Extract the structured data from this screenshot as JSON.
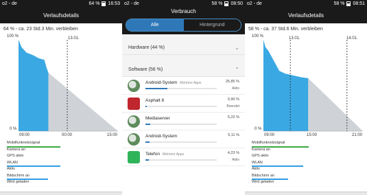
{
  "colors": {
    "accent": "#2f9ee0",
    "chart_fill": "#3aa8e3",
    "projection": "#cfd3d8",
    "green": "#39a845",
    "blue": "#2f78b8",
    "title_bg": "#1a1a1a"
  },
  "panels": [
    {
      "status": {
        "carrier": "o2 - de",
        "battery": "64 %",
        "time": "16:53"
      },
      "title": "Verlaufsdetails",
      "summary": "64 % - ca. 23 Std.3 Min. verbleiben",
      "y_top": "100 %",
      "y_bottom": "0 %",
      "marker": "13.01.",
      "x_labels": [
        "09:00",
        "00:00",
        "15:00"
      ],
      "events": [
        {
          "label": "Mobilfunknetzsignal",
          "color": "#39a845",
          "len": 0.52
        },
        {
          "label": "Kamera an",
          "color": "#2f9ee0",
          "len": 0.0
        },
        {
          "label": "GPS aktiv",
          "color": "#2f9ee0",
          "len": 0.0
        },
        {
          "label": "WLAN",
          "color": "#2f9ee0",
          "len": 0.52
        },
        {
          "label": "Aktiv",
          "color": "#2f9ee0",
          "len": 0.0
        },
        {
          "label": "Bildschirm an",
          "color": "#2f9ee0",
          "len": 0.4
        },
        {
          "label": "Wird geladen",
          "color": "#2f9ee0",
          "len": 0.0
        }
      ]
    },
    {
      "status": {
        "carrier": "o2 - de",
        "battery": "58 %",
        "time": "08:50"
      },
      "title": "Verbrauch",
      "tabs": [
        {
          "label": "Alle",
          "active": true
        },
        {
          "label": "Hintergrund",
          "active": false
        }
      ],
      "hardware_label": "Hardware (44 %)",
      "software_label": "Software (56 %)",
      "apps": [
        {
          "name": "Android-System",
          "tag": "Mehrere Apps",
          "percent": "25,85 %",
          "status": "Aktiv",
          "usage": 0.2585,
          "icon": "android-system-icon"
        },
        {
          "name": "Asphalt 8",
          "tag": "",
          "percent": "0,90 %",
          "status": "Beendet",
          "usage": 0.009,
          "icon": "asphalt-8-icon"
        },
        {
          "name": "Mediaserver",
          "tag": "",
          "percent": "5,22 %",
          "status": "",
          "usage": 0.0522,
          "icon": "mediaserver-icon"
        },
        {
          "name": "Android-System",
          "tag": "",
          "percent": "5,11 %",
          "status": "",
          "usage": 0.0511,
          "icon": "android-system-icon"
        },
        {
          "name": "Telefon",
          "tag": "Mehrere Apps",
          "percent": "4,23 %",
          "status": "Aktiv",
          "usage": 0.0423,
          "icon": "telefon-icon"
        }
      ]
    },
    {
      "status": {
        "carrier": "o2 - de",
        "battery": "58 %",
        "time": "08:51"
      },
      "title": "Verlaufsdetails",
      "summary": "58 % - ca. 37 Std.6 Min. verbleiben",
      "y_top": "100 %",
      "y_bottom": "0 %",
      "markers": [
        "13.01.",
        "14.01."
      ],
      "x_labels": [
        "09:00",
        "15:00",
        "21:00"
      ],
      "events": [
        {
          "label": "Mobilfunknetzsignal",
          "color": "#39a845",
          "len": 0.55
        },
        {
          "label": "Kamera an",
          "color": "#2f9ee0",
          "len": 0.0
        },
        {
          "label": "GPS aktiv",
          "color": "#2f9ee0",
          "len": 0.0
        },
        {
          "label": "WLAN",
          "color": "#2f9ee0",
          "len": 0.5
        },
        {
          "label": "Aktiv",
          "color": "#2f9ee0",
          "len": 0.0
        },
        {
          "label": "Bildschirm an",
          "color": "#2f9ee0",
          "len": 0.35
        },
        {
          "label": "Wird geladen",
          "color": "#2f9ee0",
          "len": 0.0
        }
      ]
    }
  ],
  "chart_data": [
    {
      "type": "area",
      "ylim": [
        0,
        100
      ],
      "x_ticks": [
        "09:00",
        "00:00",
        "15:00"
      ],
      "series": [
        {
          "name": "",
          "points": [
            [
              0,
              100
            ],
            [
              0.03,
              92
            ],
            [
              0.08,
              86
            ],
            [
              0.15,
              83
            ],
            [
              0.2,
              80
            ],
            [
              0.26,
              78
            ],
            [
              0.28,
              70
            ],
            [
              0.3,
              64
            ]
          ]
        }
      ],
      "projection": [
        [
          0.3,
          64
        ],
        [
          1.0,
          0
        ]
      ]
    },
    {
      "type": "area",
      "ylim": [
        0,
        100
      ],
      "x_ticks": [
        "09:00",
        "15:00",
        "21:00"
      ],
      "series": [
        {
          "name": "",
          "points": [
            [
              0,
              100
            ],
            [
              0.02,
              92
            ],
            [
              0.05,
              88
            ],
            [
              0.12,
              74
            ],
            [
              0.16,
              66
            ],
            [
              0.22,
              63
            ],
            [
              0.3,
              61
            ],
            [
              0.38,
              59
            ],
            [
              0.45,
              58
            ]
          ]
        }
      ],
      "projection": [
        [
          0.45,
          58
        ],
        [
          1.0,
          0
        ]
      ]
    }
  ]
}
